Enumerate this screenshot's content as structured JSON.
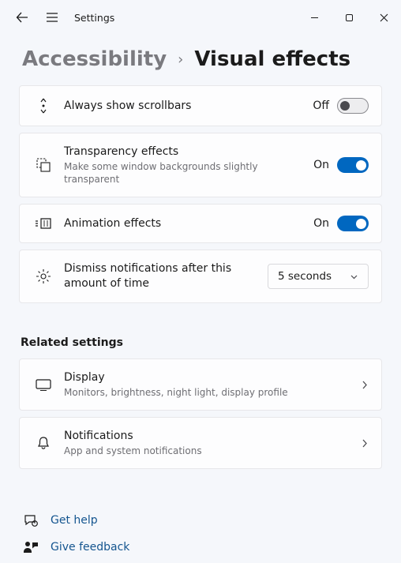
{
  "titlebar": {
    "title": "Settings"
  },
  "breadcrumb": {
    "parent": "Accessibility",
    "separator": "›",
    "current": "Visual effects"
  },
  "rows": {
    "scrollbars": {
      "title": "Always show scrollbars",
      "state": "Off"
    },
    "transparency": {
      "title": "Transparency effects",
      "sub": "Make some window backgrounds slightly transparent",
      "state": "On"
    },
    "animation": {
      "title": "Animation effects",
      "state": "On"
    },
    "dismiss": {
      "title": "Dismiss notifications after this amount of time",
      "value": "5 seconds"
    }
  },
  "section": {
    "related": "Related settings"
  },
  "related": {
    "display": {
      "title": "Display",
      "sub": "Monitors, brightness, night light, display profile"
    },
    "notifications": {
      "title": "Notifications",
      "sub": "App and system notifications"
    }
  },
  "help": {
    "gethelp": "Get help",
    "feedback": "Give feedback"
  }
}
